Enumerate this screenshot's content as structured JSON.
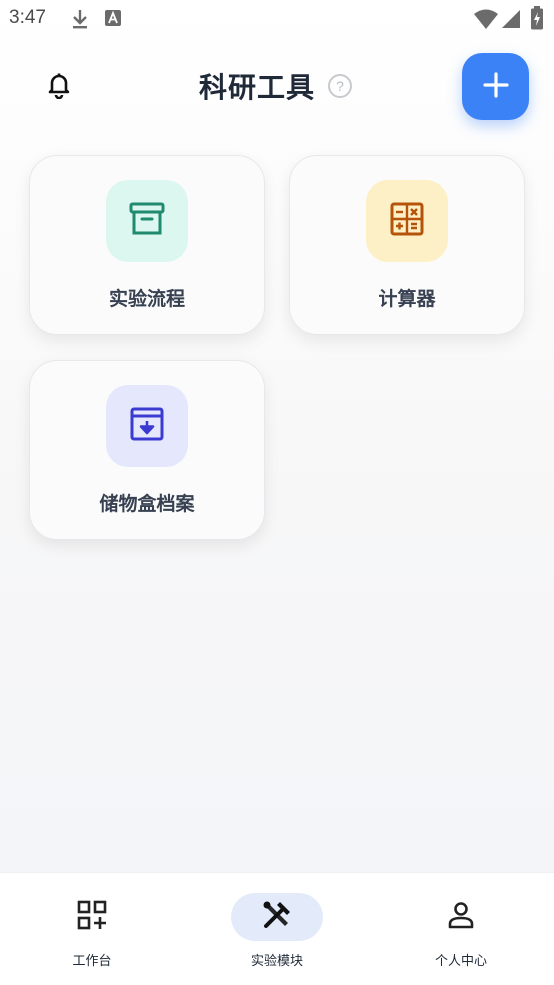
{
  "status_bar": {
    "time": "3:47",
    "icons": [
      "download-icon",
      "text-a-icon",
      "wifi-icon",
      "signal-icon",
      "battery-charging-icon"
    ]
  },
  "header": {
    "title": "科研工具",
    "help_glyph": "?",
    "left_icon": "bell-icon",
    "add_icon": "plus-icon",
    "accent_color": "#3b82f6"
  },
  "cards": [
    {
      "label": "实验流程",
      "icon": "archive-box-icon",
      "icon_bg": "#dcf7ef",
      "icon_color": "#1f8a6e"
    },
    {
      "label": "计算器",
      "icon": "calculator-icon",
      "icon_bg": "#fdf0c6",
      "icon_color": "#b45309"
    },
    {
      "label": "储物盒档案",
      "icon": "archive-download-icon",
      "icon_bg": "#e5e8fd",
      "icon_color": "#3b3bd1"
    }
  ],
  "bottom_nav": {
    "items": [
      {
        "label": "工作台",
        "icon": "grid-plus-icon",
        "active": false
      },
      {
        "label": "实验模块",
        "icon": "tools-icon",
        "active": true
      },
      {
        "label": "个人中心",
        "icon": "person-icon",
        "active": false
      }
    ],
    "active_bg": "#e3ebfb"
  }
}
